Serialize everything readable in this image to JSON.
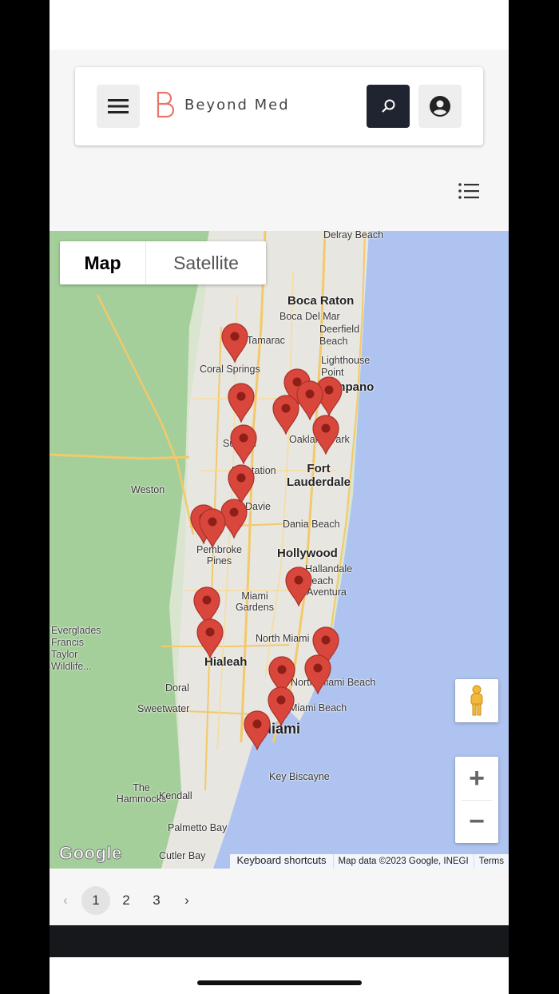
{
  "header": {
    "brand": "Beyond Med",
    "menu_icon": "hamburger-icon",
    "search_icon": "search-icon",
    "user_icon": "account-circle-icon",
    "brand_color": "#e8776a"
  },
  "list_toggle_icon": "list-view-icon",
  "map": {
    "type_map": "Map",
    "type_satellite": "Satellite",
    "zoom_in": "+",
    "zoom_out": "−",
    "google": "Google",
    "keyboard_shortcuts": "Keyboard shortcuts",
    "map_data": "Map data ©2023 Google, INEGI",
    "terms": "Terms",
    "marker_color": "#d9463c",
    "labels": {
      "delray": "Delray Beach",
      "boca": "Boca Raton",
      "bocadelmar": "Boca Del Mar",
      "deerfield": "Deerfield Beach",
      "lighthouse": "Lighthouse Point",
      "coralsprings": "Coral Springs",
      "pompano": "Pompano",
      "oakland": "Oakland Park",
      "fortlaud": "Fort Lauderdale",
      "plantation": "Plantation",
      "weston": "Weston",
      "dania": "Dania Beach",
      "hollywood": "Hollywood",
      "hallandale": "Hallandale Beach",
      "aventura": "Aventura",
      "pembroke": "Pembroke Pines",
      "miamigardens": "Miami Gardens",
      "northmiami": "North Miami",
      "everglades": "Everglades Francis Taylor Wildlife...",
      "hialeah": "Hialeah",
      "miamibeach": "Miami Beach",
      "northmiamibeach": "North Miami Beach",
      "doral": "Doral",
      "sweetwater": "Sweetwater",
      "miami": "Miami",
      "keybiscayne": "Key Biscayne",
      "thehammocks": "The Hammocks",
      "kendall": "Kendall",
      "palmetto": "Palmetto Bay",
      "cutler": "Cutler Bay",
      "davie": "Davie",
      "sunrise": "Sunrise",
      "tamarac": "Tamarac"
    },
    "markers": 20
  },
  "pagination": {
    "prev": "‹",
    "pages": [
      "1",
      "2",
      "3"
    ],
    "current": "1",
    "next": "›"
  }
}
